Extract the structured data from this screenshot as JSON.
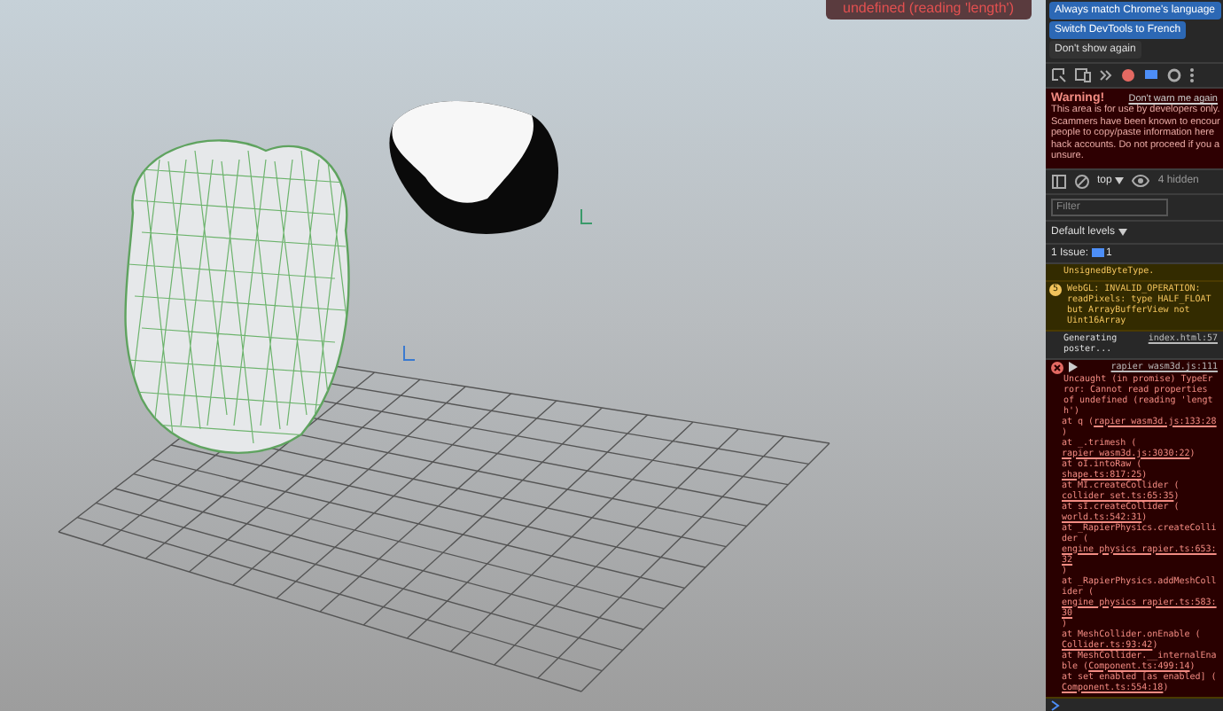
{
  "viewport": {
    "error_toast": "undefined (reading 'length')"
  },
  "devtools": {
    "language_buttons": [
      "Always match Chrome's language",
      "Switch DevTools to French"
    ],
    "dismiss_button": "Don't show again",
    "warning": {
      "title": "Warning!",
      "link": "Don't warn me again",
      "lines": [
        "This area is for use by developers only.",
        "Scammers have been known to encour",
        "people to copy/paste information here",
        "hack accounts. Do not proceed if you a",
        "unsure."
      ]
    },
    "context": "top",
    "hidden_count": "4 hidden",
    "filter": {
      "placeholder": "Filter"
    },
    "levels": "Default levels",
    "issues": {
      "label": "1 Issue:",
      "count": "1"
    },
    "messages": [
      {
        "kind": "warning",
        "text": "UnsignedByteType."
      },
      {
        "kind": "warning",
        "count": "5",
        "text": "WebGL: INVALID_OPERATION: readPixels: type HALF_FLOAT but ArrayBufferView not Uint16Array"
      },
      {
        "kind": "info",
        "text": "Generating poster...",
        "source": "index.html:57"
      },
      {
        "kind": "error",
        "source": "rapier_wasm3d.js:111",
        "text": "Uncaught (in promise) TypeError: Cannot read properties of undefined (reading 'length')",
        "stack": [
          {
            "pre": "at q (",
            "link": "rapier_wasm3d.js:133:28",
            "post": ")"
          },
          {
            "pre": "at _.trimesh (",
            "link": "rapier_wasm3d.js:3030:22",
            "post": ")"
          },
          {
            "pre": "at oI.intoRaw (",
            "link": "shape.ts:817:25",
            "post": ")"
          },
          {
            "pre": "at MI.createCollider (",
            "link": "collider_set.ts:65:35",
            "post": ")"
          },
          {
            "pre": "at sI.createCollider (",
            "link": "world.ts:542:31",
            "post": ")"
          },
          {
            "pre": "at _RapierPhysics.createCollider (",
            "link": "engine_physics_rapier.ts:653:32",
            "post": ")"
          },
          {
            "pre": "at _RapierPhysics.addMeshCollider (",
            "link": "engine_physics_rapier.ts:583:30",
            "post": ")"
          },
          {
            "pre": "at MeshCollider.onEnable (",
            "link": "Collider.ts:93:42",
            "post": ")"
          },
          {
            "pre": "at MeshCollider.__internalEnable (",
            "link": "Component.ts:499:14",
            "post": ")"
          },
          {
            "pre": "at set enabled [as enabled] (",
            "link": "Component.ts:554:18",
            "post": ")"
          }
        ]
      }
    ]
  }
}
